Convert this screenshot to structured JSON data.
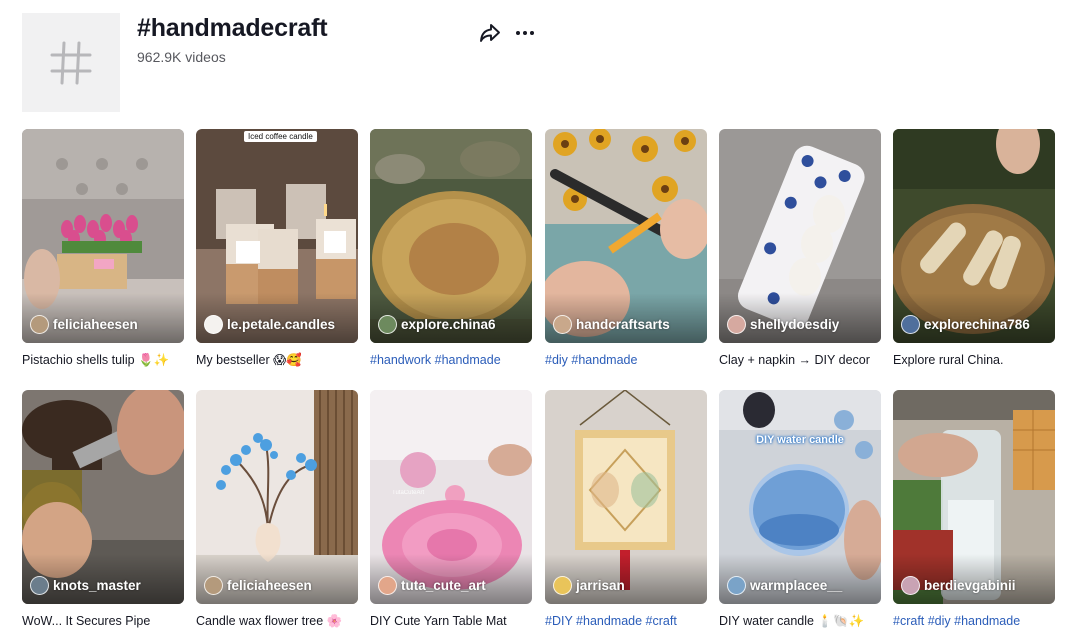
{
  "tag": {
    "title": "#handmadecraft",
    "count": "962.9K videos"
  },
  "icons": {
    "hashtag": "hashtag-icon",
    "share": "share-icon",
    "more": "more-options-icon"
  },
  "videos": [
    {
      "author": "feliciaheesen",
      "caption": "Pistachio shells tulip 🌷✨",
      "tags": false
    },
    {
      "author": "le.petale.candles",
      "caption": "My bestseller 😱🥰",
      "tags": false,
      "overlay_text": "Iced coffee candle"
    },
    {
      "author": "explore.china6",
      "caption": "#handwork #handmade",
      "tags": true
    },
    {
      "author": "handcraftsarts",
      "caption": "#diy #handmade",
      "tags": true
    },
    {
      "author": "shellydoesdiy",
      "caption": "Clay + napkin → DIY decor",
      "tags": false
    },
    {
      "author": "explorechina786",
      "caption": "Explore rural China.",
      "tags": false
    },
    {
      "author": "knots_master",
      "caption": "WoW... It Secures Pipe",
      "tags": false
    },
    {
      "author": "feliciaheesen",
      "caption": "Candle wax flower tree 🌸",
      "tags": false
    },
    {
      "author": "tuta_cute_art",
      "caption": "DIY Cute Yarn Table Mat",
      "tags": false,
      "overlay_text": "TutaCuteArt"
    },
    {
      "author": "jarrisan",
      "caption": "#DIY #handmade #craft",
      "tags": true
    },
    {
      "author": "warmplacee__",
      "caption": "DIY water candle 🕯️🐚✨",
      "tags": false,
      "overlay_text": "DIY water candle"
    },
    {
      "author": "berdievgabinii",
      "caption": "#craft #diy #handmade",
      "tags": true
    }
  ]
}
